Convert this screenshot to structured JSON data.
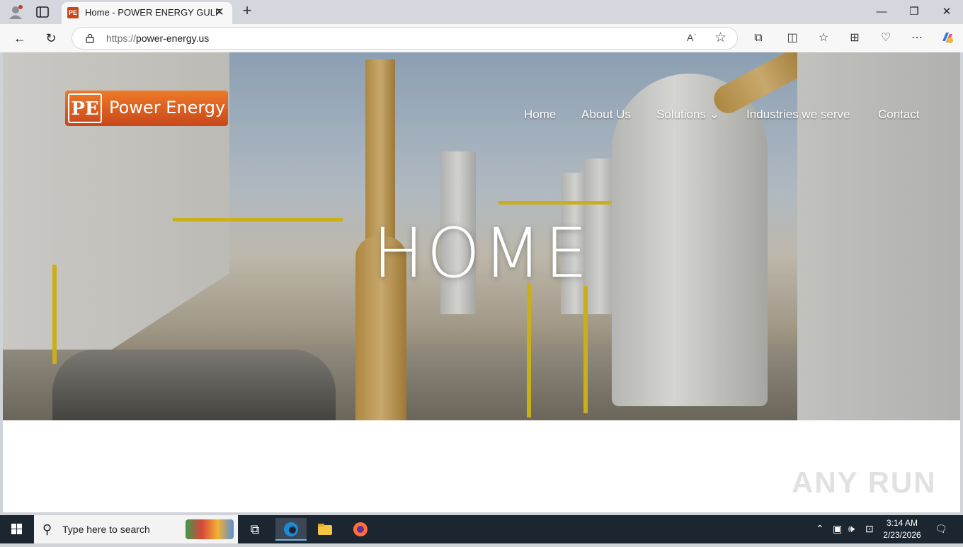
{
  "browser": {
    "tab_title": "Home - POWER ENERGY GULF",
    "tab_close": "✕",
    "new_tab": "+",
    "url_scheme": "https://",
    "url_host": "power-energy.us",
    "read_aloud": "Aʾ",
    "window_controls": {
      "minimize": "—",
      "restore": "❐",
      "close": "✕"
    }
  },
  "site": {
    "logo_mark": "PE",
    "logo_text": "Power Energy",
    "nav": {
      "home": "Home",
      "about": "About Us",
      "solutions": "Solutions",
      "solutions_caret": "⌄",
      "industries": "Industries we serve",
      "contact": "Contact"
    },
    "hero_title": "HOME"
  },
  "watermark": "ANY RUN",
  "taskbar": {
    "search_placeholder": "Type here to search",
    "time": "3:14 AM",
    "date": "2/23/2026"
  }
}
